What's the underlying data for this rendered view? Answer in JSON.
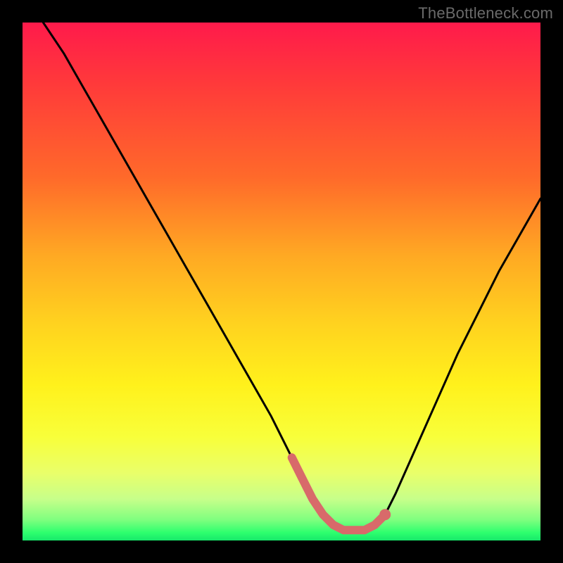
{
  "watermark": "TheBottleneck.com",
  "colors": {
    "background": "#000000",
    "gradient_top": "#ff1a4b",
    "gradient_bottom": "#17e86a",
    "curve": "#000000",
    "highlight": "#d86a6a"
  },
  "chart_data": {
    "type": "line",
    "title": "",
    "xlabel": "",
    "ylabel": "",
    "xlim": [
      0,
      100
    ],
    "ylim": [
      0,
      100
    ],
    "series": [
      {
        "name": "bottleneck-curve",
        "x": [
          4,
          8,
          12,
          16,
          20,
          24,
          28,
          32,
          36,
          40,
          44,
          48,
          50,
          52,
          54,
          56,
          58,
          60,
          62,
          64,
          66,
          68,
          70,
          72,
          76,
          80,
          84,
          88,
          92,
          96,
          100
        ],
        "values": [
          100,
          94,
          87,
          80,
          73,
          66,
          59,
          52,
          45,
          38,
          31,
          24,
          20,
          16,
          12,
          8,
          5,
          3,
          2,
          2,
          2,
          3,
          5,
          9,
          18,
          27,
          36,
          44,
          52,
          59,
          66
        ]
      },
      {
        "name": "highlight-segment",
        "x": [
          52,
          54,
          56,
          58,
          60,
          62,
          64,
          66,
          68,
          70
        ],
        "values": [
          16,
          12,
          8,
          5,
          3,
          2,
          2,
          2,
          3,
          5
        ]
      }
    ],
    "annotations": []
  }
}
